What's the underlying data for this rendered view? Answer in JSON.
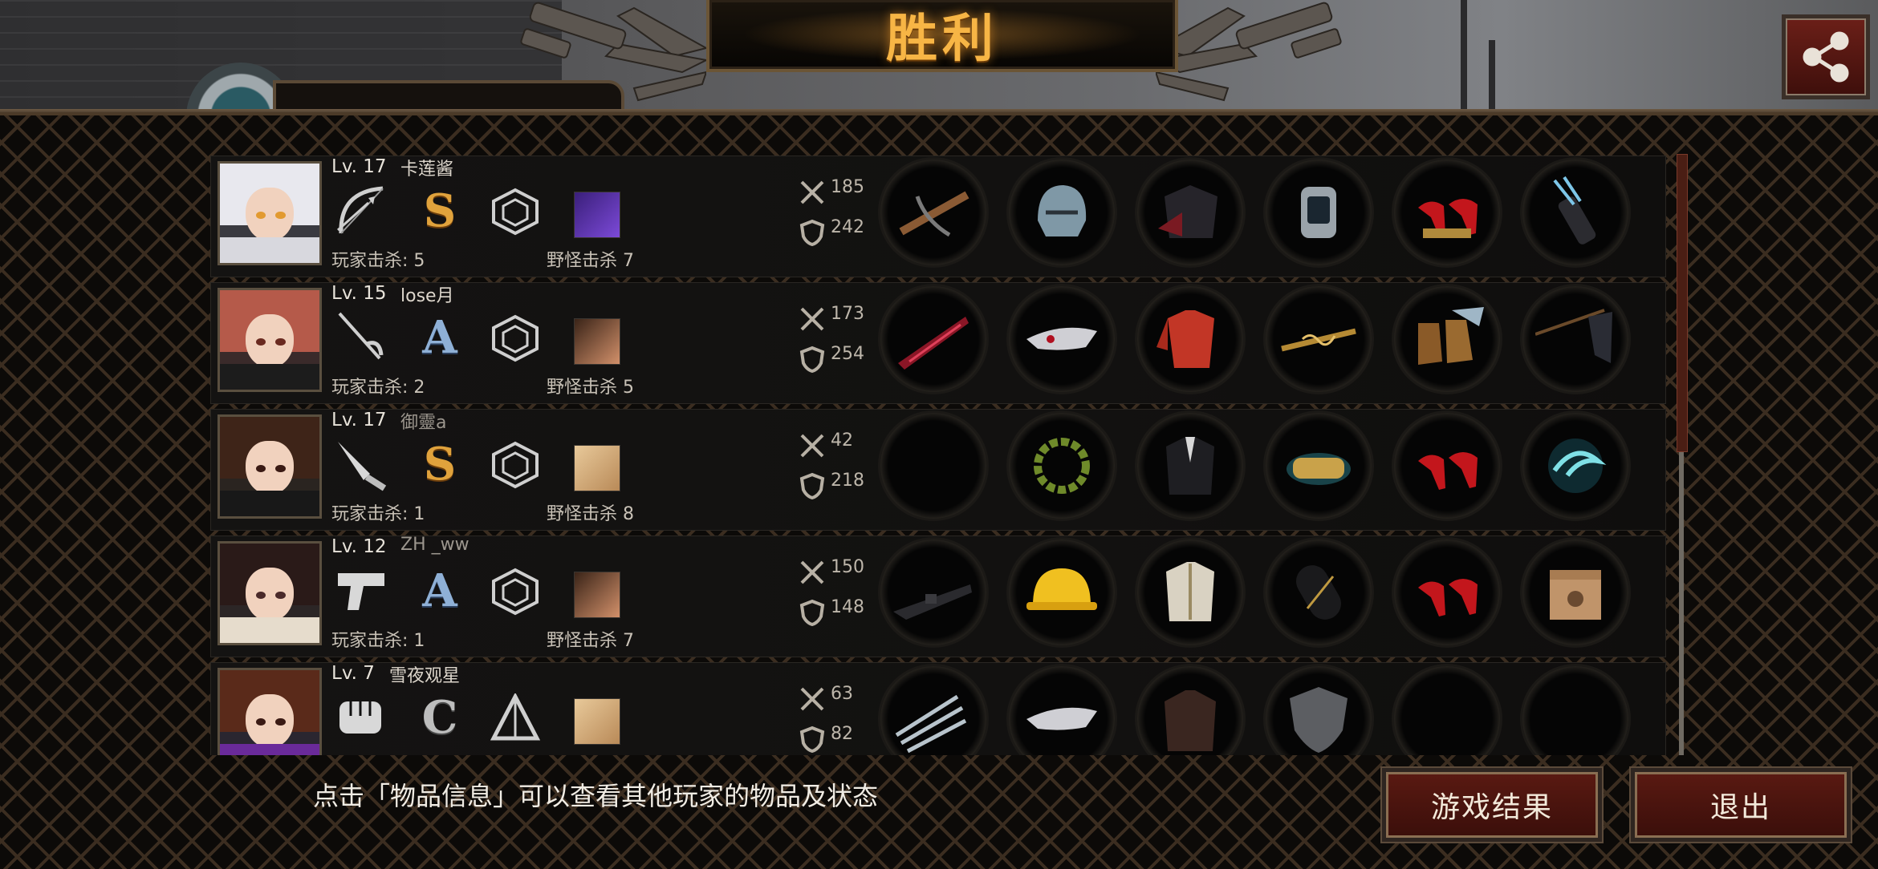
{
  "header": {
    "title": "胜利",
    "share_icon": "share-icon"
  },
  "colors": {
    "title": "#f7b545",
    "button_bg": "#5a1a12",
    "panel_lattice": "#3b2d20"
  },
  "players": [
    {
      "level": "Lv. 17",
      "name": "卡莲酱",
      "grade": "S",
      "weapon_icon": "bow-icon",
      "class_icon": "rank-emblem-icon",
      "pet_icon": "purple-creature-icon",
      "atk": "185",
      "def": "242",
      "player_kills": "玩家击杀: 5",
      "monster_kills": "野怪击杀 7",
      "items": [
        "crossbow-icon",
        "knight-helmet-icon",
        "dark-coat-icon",
        "wristwatch-icon",
        "red-heels-icon",
        "quiver-icon"
      ]
    },
    {
      "level": "Lv. 15",
      "name": "lose月",
      "grade": "A",
      "weapon_icon": "rapier-icon",
      "class_icon": "rank-emblem-icon",
      "pet_icon": "goggles-creature-icon",
      "atk": "173",
      "def": "254",
      "player_kills": "玩家击杀: 2",
      "monster_kills": "野怪击杀 5",
      "items": [
        "crimson-blade-icon",
        "mask-icon",
        "red-shirt-icon",
        "golden-rod-icon",
        "ornate-boots-icon",
        "flag-icon"
      ]
    },
    {
      "level": "Lv. 17",
      "name": "御靈a",
      "grade": "S",
      "weapon_icon": "knife-icon",
      "class_icon": "rank-emblem-icon",
      "pet_icon": "tan-creature-icon",
      "atk": "42",
      "def": "218",
      "player_kills": "玩家击杀: 1",
      "monster_kills": "野怪击杀 8",
      "items": [
        "",
        "laurel-wreath-icon",
        "black-suit-icon",
        "gold-bracelet-icon",
        "red-heels-icon",
        "spirit-orb-icon"
      ]
    },
    {
      "level": "Lv. 12",
      "name": "ZH _ww",
      "grade": "A",
      "weapon_icon": "pistol-icon",
      "class_icon": "rank-emblem-icon",
      "pet_icon": "goggles-creature-icon",
      "atk": "150",
      "def": "148",
      "player_kills": "玩家击杀: 1",
      "monster_kills": "野怪击杀 7",
      "items": [
        "rifle-icon",
        "hard-hat-icon",
        "white-armor-icon",
        "black-capsule-icon",
        "red-heels-icon",
        "cat-box-icon"
      ]
    },
    {
      "level": "Lv. 7",
      "name": "雪夜观星",
      "grade": "C",
      "weapon_icon": "fist-icon",
      "class_icon": "triangle-emblem-icon",
      "pet_icon": "tan-creature-icon",
      "atk": "63",
      "def": "82",
      "player_kills": "",
      "monster_kills": "",
      "items": [
        "claw-icon",
        "mask-icon",
        "leather-jacket-icon",
        "shield-icon",
        "",
        ""
      ]
    }
  ],
  "footer": {
    "hint": "点击「物品信息」可以查看其他玩家的物品及状态",
    "results_label": "游戏结果",
    "exit_label": "退出"
  }
}
